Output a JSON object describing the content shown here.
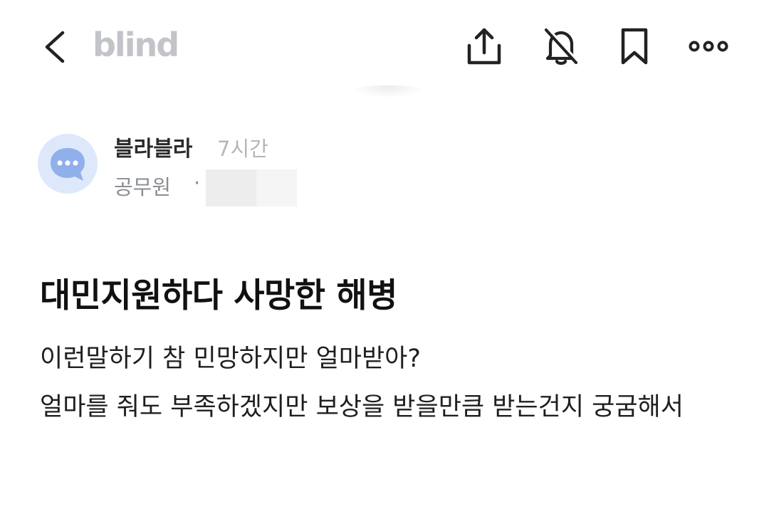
{
  "header": {
    "logo": "blind",
    "icons": {
      "back": "chevron-left-icon",
      "share": "share-icon",
      "notifications": "bell-off-icon",
      "bookmark": "bookmark-icon",
      "more": "more-horizontal-icon"
    }
  },
  "post": {
    "author": "블라블라",
    "time": "7시간",
    "organization": "공무원",
    "separator": "·",
    "title": "대민지원하다 사망한 해병",
    "body": [
      "이런말하기 참 민망하지만 얼마받아?",
      "얼마를 줘도 부족하겠지만 보상을 받을만큼 받는건지 궁굼해서"
    ]
  },
  "colors": {
    "logo": "#c2c4c9",
    "avatar_bg": "#dde8fb",
    "avatar_icon": "#8fb0ea",
    "muted_text": "#8a8d92"
  }
}
